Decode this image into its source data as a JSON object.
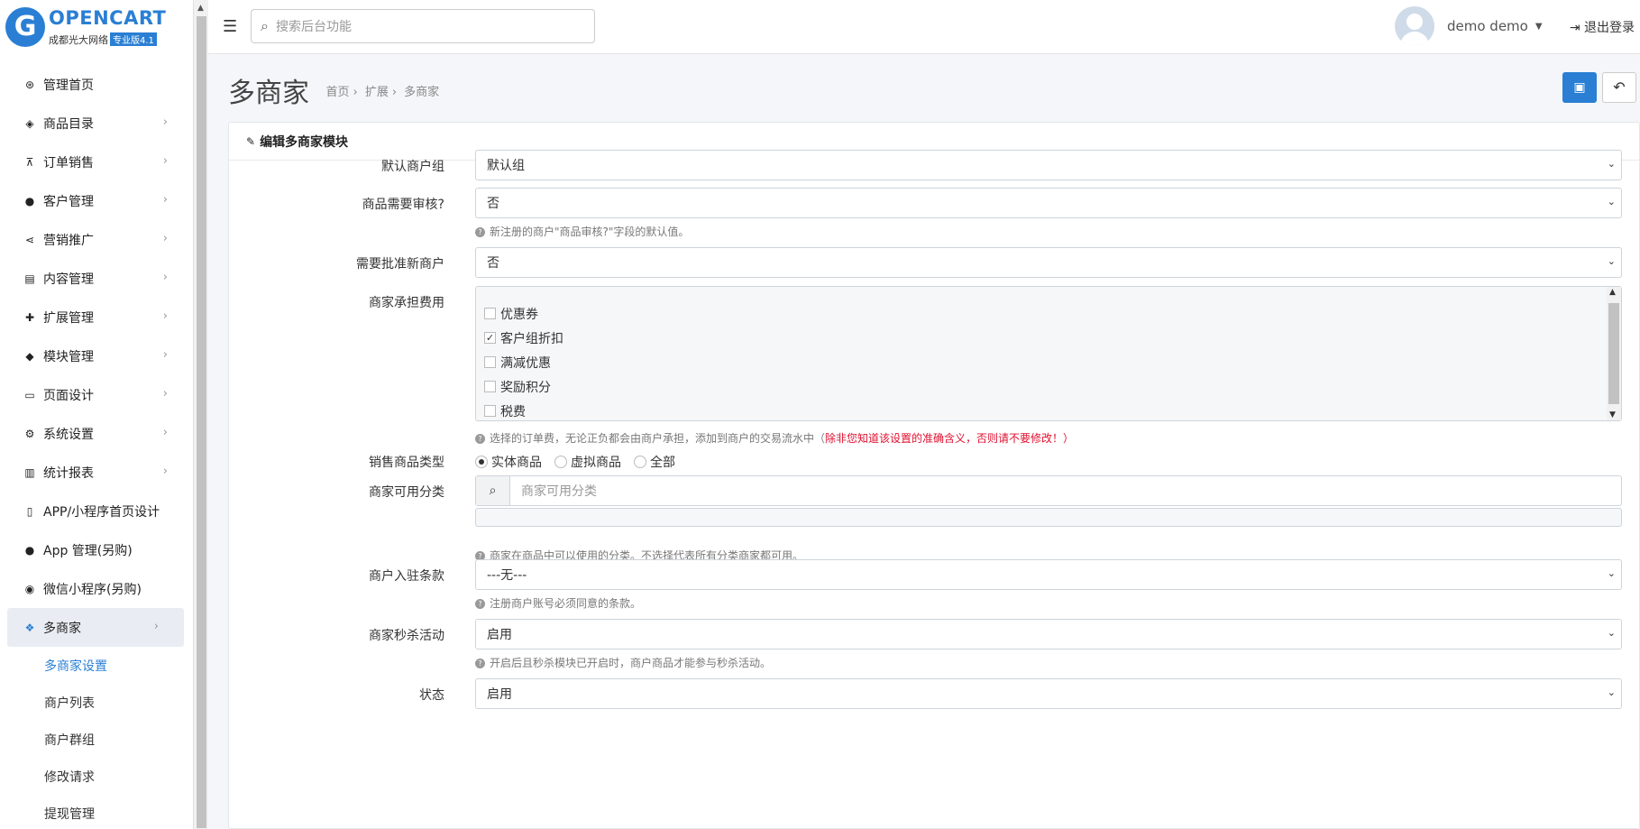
{
  "logo": {
    "letter": "G",
    "brand": "OPENCART",
    "company": "成都光大网络",
    "version": "专业版4.1"
  },
  "sidebar": {
    "items": [
      {
        "label": "管理首页",
        "icon": "⊛"
      },
      {
        "label": "商品目录",
        "icon": "◈"
      },
      {
        "label": "订单销售",
        "icon": "⊼"
      },
      {
        "label": "客户管理",
        "icon": "●"
      },
      {
        "label": "营销推广",
        "icon": "⋖"
      },
      {
        "label": "内容管理",
        "icon": "▤"
      },
      {
        "label": "扩展管理",
        "icon": "✚"
      },
      {
        "label": "模块管理",
        "icon": "◆"
      },
      {
        "label": "页面设计",
        "icon": "▭"
      },
      {
        "label": "系统设置",
        "icon": "⚙"
      },
      {
        "label": "统计报表",
        "icon": "▥"
      },
      {
        "label": "APP/小程序首页设计",
        "icon": "▯"
      },
      {
        "label": "App 管理(另购)",
        "icon": "●"
      },
      {
        "label": "微信小程序(另购)",
        "icon": "◉"
      },
      {
        "label": "多商家",
        "icon": "❖"
      }
    ],
    "subitems": [
      {
        "label": "多商家设置"
      },
      {
        "label": "商户列表"
      },
      {
        "label": "商户群组"
      },
      {
        "label": "修改请求"
      },
      {
        "label": "提现管理"
      }
    ]
  },
  "topbar": {
    "search_placeholder": "搜索后台功能",
    "username": "demo demo",
    "logout": "退出登录"
  },
  "page": {
    "title": "多商家",
    "breadcrumb": [
      "首页",
      "扩展",
      "多商家"
    ]
  },
  "card": {
    "title": "编辑多商家模块"
  },
  "form": {
    "default_group": {
      "label": "默认商户组",
      "value": "默认组"
    },
    "product_review": {
      "label": "商品需要审核?",
      "value": "否",
      "help": "新注册的商户\"商品审核?\"字段的默认值。"
    },
    "approve_new": {
      "label": "需要批准新商户",
      "value": "否"
    },
    "fees": {
      "label": "商家承担费用",
      "options": [
        {
          "label": "优惠券",
          "checked": false
        },
        {
          "label": "客户组折扣",
          "checked": true
        },
        {
          "label": "满减优惠",
          "checked": false
        },
        {
          "label": "奖励积分",
          "checked": false
        },
        {
          "label": "税费",
          "checked": false
        }
      ],
      "help": "选择的订单费，无论正负都会由商户承担，添加到商户的交易流水中（",
      "help_warn": "除非您知道该设置的准确含义，否则请不要修改！",
      "help_end": "）"
    },
    "product_type": {
      "label": "销售商品类型",
      "options": [
        "实体商品",
        "虚拟商品",
        "全部"
      ],
      "selected": "实体商品"
    },
    "categories": {
      "label": "商家可用分类",
      "placeholder": "商家可用分类",
      "help": "商家在商品中可以使用的分类。不选择代表所有分类商家都可用。"
    },
    "agreement": {
      "label": "商户入驻条款",
      "value": "---无---",
      "help": "注册商户账号必须同意的条款。"
    },
    "flash_sale": {
      "label": "商家秒杀活动",
      "value": "启用",
      "help": "开启后且秒杀模块已开启时，商户商品才能参与秒杀活动。"
    },
    "status": {
      "label": "状态",
      "value": "启用"
    }
  }
}
